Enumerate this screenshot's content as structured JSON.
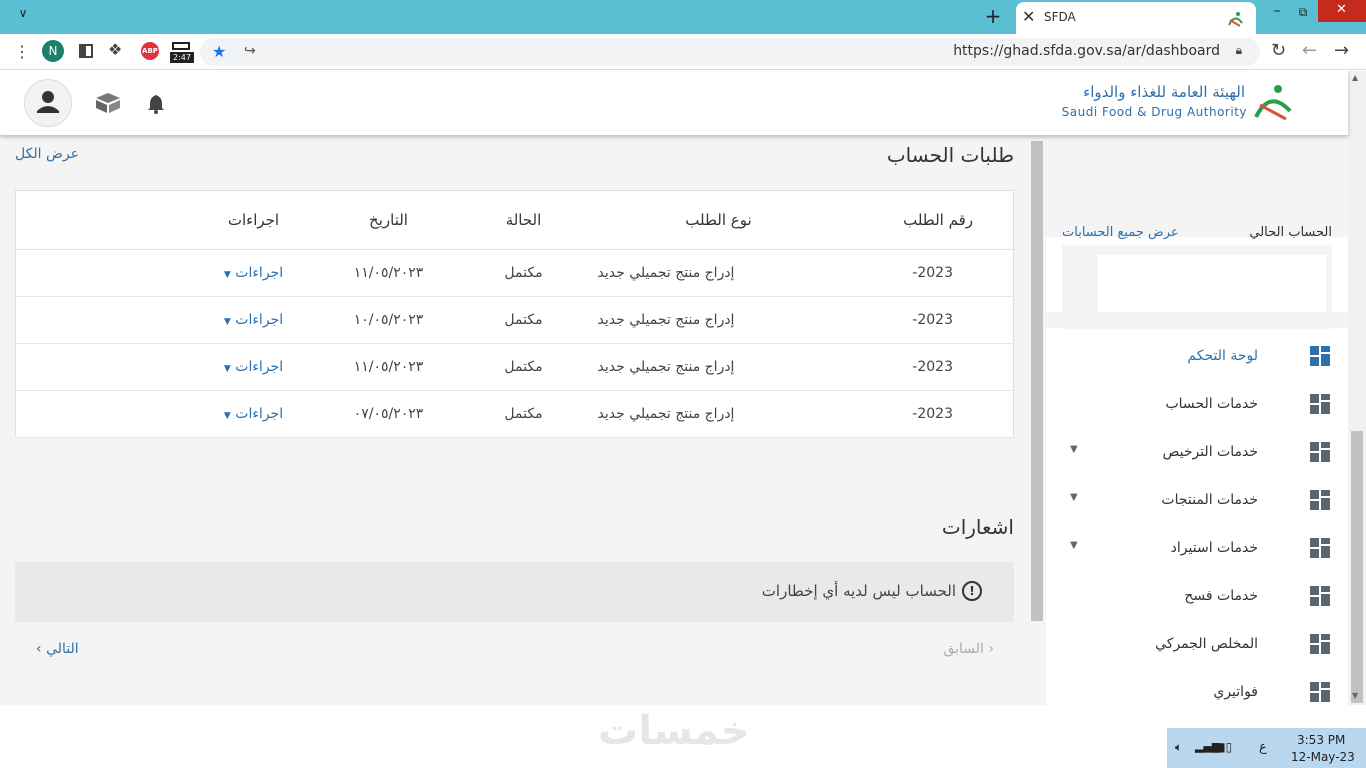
{
  "browser": {
    "tab_title": "SFDA",
    "url": "https://ghad.sfda.gov.sa/ar/dashboard",
    "profile_initial": "N",
    "extension_badge": "ABP",
    "extension_time": "2:47"
  },
  "header": {
    "logo_ar": "الهيئة العامة للغذاء والدواء",
    "logo_en": "Saudi Food & Drug Authority",
    "logo_mark": "SFDA"
  },
  "account": {
    "current_label": "الحساب الحالي",
    "view_all_link": "عرض جميع الحسابات"
  },
  "nav": {
    "items": [
      {
        "label": "لوحة التحكم",
        "active": true,
        "dropdown": false
      },
      {
        "label": "خدمات الحساب",
        "active": false,
        "dropdown": false
      },
      {
        "label": "خدمات الترخيص",
        "active": false,
        "dropdown": true
      },
      {
        "label": "خدمات المنتجات",
        "active": false,
        "dropdown": true
      },
      {
        "label": "خدمات استيراد",
        "active": false,
        "dropdown": true
      },
      {
        "label": "خدمات فسح",
        "active": false,
        "dropdown": false
      },
      {
        "label": "المخلص الجمركي",
        "active": false,
        "dropdown": false
      },
      {
        "label": "فواتيري",
        "active": false,
        "dropdown": false
      }
    ]
  },
  "requests": {
    "title": "طلبات الحساب",
    "view_all": "عرض الكل",
    "columns": [
      "رقم الطلب",
      "نوع الطلب",
      "الحالة",
      "التاريخ",
      "اجراءات"
    ],
    "rows": [
      {
        "number": "2023-",
        "type": "إدراج منتج تجميلي جديد",
        "status": "مكتمل",
        "date": "١١/٠٥/٢٠٢٣",
        "action": "اجراءات"
      },
      {
        "number": "2023-",
        "type": "إدراج منتج تجميلي جديد",
        "status": "مكتمل",
        "date": "١٠/٠٥/٢٠٢٣",
        "action": "اجراءات"
      },
      {
        "number": "2023-",
        "type": "إدراج منتج تجميلي جديد",
        "status": "مكتمل",
        "date": "١١/٠٥/٢٠٢٣",
        "action": "اجراءات"
      },
      {
        "number": "2023-",
        "type": "إدراج منتج تجميلي جديد",
        "status": "مكتمل",
        "date": "٠٧/٠٥/٢٠٢٣",
        "action": "اجراءات"
      }
    ]
  },
  "notifications": {
    "title": "اشعارات",
    "empty_message": "الحساب ليس لديه أي إخطارات"
  },
  "pagination": {
    "prev": "السابق",
    "next": "التالي"
  },
  "taskbar": {
    "time": "3:53 PM",
    "date": "12-May-23",
    "lang": "ع"
  },
  "watermark": "خمسات",
  "colors": {
    "titlebar": "#5bbfd4",
    "link": "#2f6fab",
    "grid_icon": "#5a6670",
    "active_icon": "#2f6fab"
  }
}
